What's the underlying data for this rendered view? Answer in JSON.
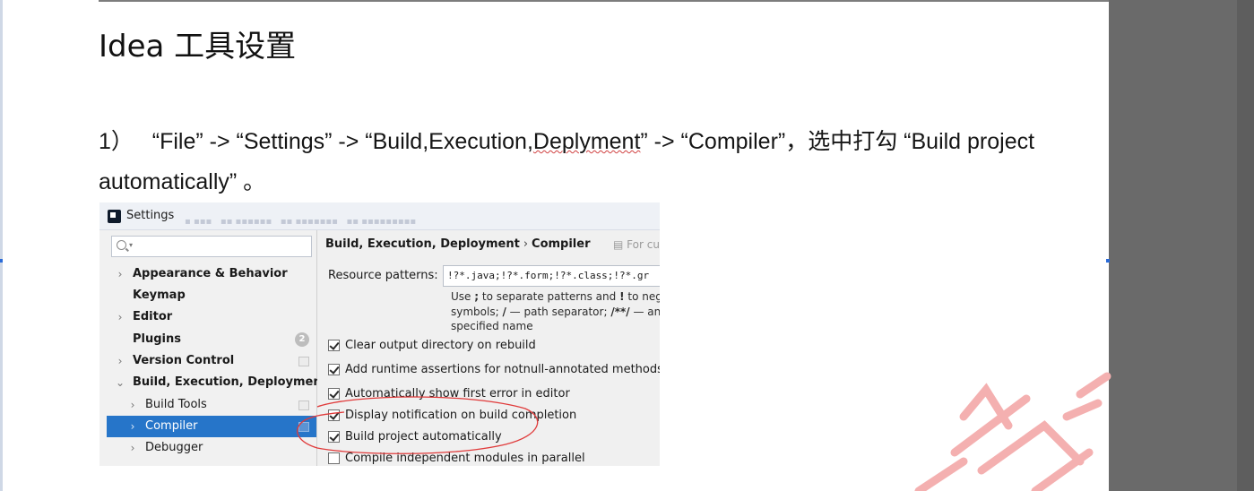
{
  "document": {
    "title": "Idea 工具设置",
    "step_number": "1）",
    "step_path_prefix": "“File” -> “Settings” -> “Build,Execution,",
    "step_path_underlined": "Deplyment",
    "step_path_suffix": "” -> “Compiler”，选中打勾 “Build project automatically” 。"
  },
  "settings_dialog": {
    "window_title": "Settings",
    "app_icon": "intellij-idea-icon",
    "search": {
      "value": "",
      "placeholder": "",
      "icon": "search-icon"
    },
    "sidebar": {
      "items": [
        {
          "label": "Appearance & Behavior",
          "expandable": true,
          "expanded": false,
          "bold": true
        },
        {
          "label": "Keymap",
          "expandable": false,
          "bold": true
        },
        {
          "label": "Editor",
          "expandable": true,
          "expanded": false,
          "bold": true
        },
        {
          "label": "Plugins",
          "expandable": false,
          "bold": true,
          "badge": "2"
        },
        {
          "label": "Version Control",
          "expandable": true,
          "expanded": false,
          "bold": true,
          "icon": "project-icon"
        },
        {
          "label": "Build, Execution, Deployment",
          "expandable": true,
          "expanded": true,
          "bold": true
        },
        {
          "label": "Build Tools",
          "expandable": true,
          "expanded": false,
          "bold": false,
          "indent": 1,
          "icon": "project-icon"
        },
        {
          "label": "Compiler",
          "expandable": true,
          "expanded": false,
          "bold": false,
          "indent": 1,
          "selected": true,
          "icon": "project-icon"
        },
        {
          "label": "Debugger",
          "expandable": true,
          "expanded": false,
          "bold": false,
          "indent": 1
        }
      ]
    },
    "breadcrumb": {
      "parent": "Build, Execution, Deployment",
      "separator": "›",
      "current": "Compiler",
      "scope_hint": "For cu"
    },
    "resource_patterns": {
      "label": "Resource patterns:",
      "value": "!?*.java;!?*.form;!?*.class;!?*.gr"
    },
    "help_text": {
      "line1_a": "Use ",
      "line1_b": ";",
      "line1_c": " to separate patterns and ",
      "line1_d": "!",
      "line1_e": " to negat",
      "line2_a": "symbols; ",
      "line2_b": "/",
      "line2_c": " — path separator; ",
      "line2_d": "/**/",
      "line2_e": " — any",
      "line3": "specified name"
    },
    "options": [
      {
        "label": "Clear output directory on rebuild",
        "checked": true
      },
      {
        "label": "Add runtime assertions for notnull-annotated methods",
        "checked": true
      },
      {
        "label": "Automatically show first error in editor",
        "checked": true
      },
      {
        "label": "Display notification on build completion",
        "checked": true
      },
      {
        "label": "Build project automatically",
        "checked": true,
        "highlighted": true
      },
      {
        "label": "Compile independent modules in parallel",
        "checked": false
      }
    ],
    "highlight_color": "#e03a3a"
  },
  "colors": {
    "selection": "#2675c9",
    "watermark": "#f2a3a3",
    "side_panel": "#6a6a6a"
  }
}
